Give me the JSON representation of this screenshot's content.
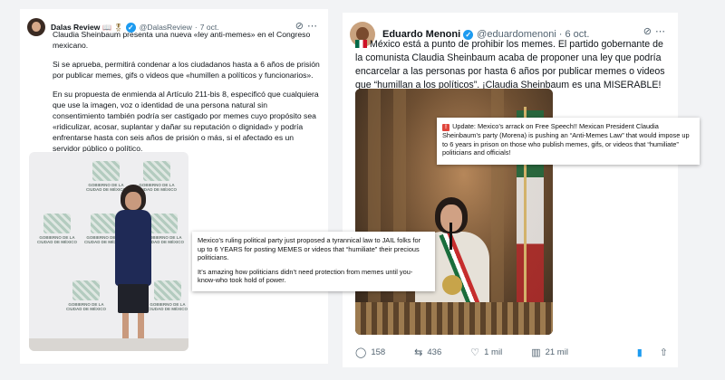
{
  "tweet1": {
    "name": "Dalas Review",
    "name_emojis": "📖 🎖",
    "handle": "@DalasReview",
    "time": "7 oct.",
    "paragraphs": [
      "Claudia Sheinbaum presenta una nueva «ley anti-memes» en el Congreso mexicano.",
      "Si se aprueba, permitirá condenar a los ciudadanos hasta a 6 años de prisión por publicar memes, gifs o videos que «humillen a políticos y funcionarios».",
      "En su propuesta de enmienda al Artículo 211-bis 8, especificó que cualquiera que use la imagen, voz o identidad de una persona natural sin consentimiento también podría ser castigado por memes cuyo propósito sea «ridiculizar, acosar, suplantar y dañar su reputación o dignidad» y podría enfrentarse hasta con seis años de prisión o más, si el afectado es un servidor público o político."
    ],
    "logo_label": "GOBIERNO DE LA CIUDAD DE MÉXICO"
  },
  "overlay1": {
    "paragraphs": [
      "Mexico’s ruling political party just proposed a tyrannical law to JAIL folks for up to 6 YEARS for posting MEMES or videos that “humiliate” their precious politicians.",
      "It’s amazing how politicians didn’t need protection from memes until you-know-who took hold of power."
    ]
  },
  "tweet2": {
    "name": "Eduardo Menoni",
    "handle": "@eduardomenoni",
    "time": "6 oct.",
    "text": "México está a punto de prohibir los memes. El partido gobernante de la comunista Claudia Sheinbaum acaba de proponer una ley que podría encarcelar a las personas por hasta 6 años por publicar memes o videos que “humillan a los políticos”. ¡Claudia Sheinbaum es una MISERABLE!",
    "actions": {
      "replies": "158",
      "reposts": "436",
      "likes": "1 mil",
      "views": "21 mil"
    }
  },
  "overlay2": {
    "text": "Update: Mexico’s arrack on Free Speech!! Mexican President Claudia Sheinbaum’s party (Morena) is pushing an “Anti-Memes Law” that would impose up to 6 years in prison on those who publish memes, gifs, or videos that “humiliate” politicians and officials!"
  },
  "icons": {
    "verified": "verified-badge-icon",
    "grok": "grok-icon",
    "more": "more-icon",
    "reply": "reply-icon",
    "repost": "repost-icon",
    "like": "like-icon",
    "views": "views-icon",
    "bookmark": "bookmark-icon",
    "share": "share-icon"
  },
  "colors": {
    "accent": "#1d9bf0",
    "text": "#0f1419",
    "muted": "#536471"
  }
}
